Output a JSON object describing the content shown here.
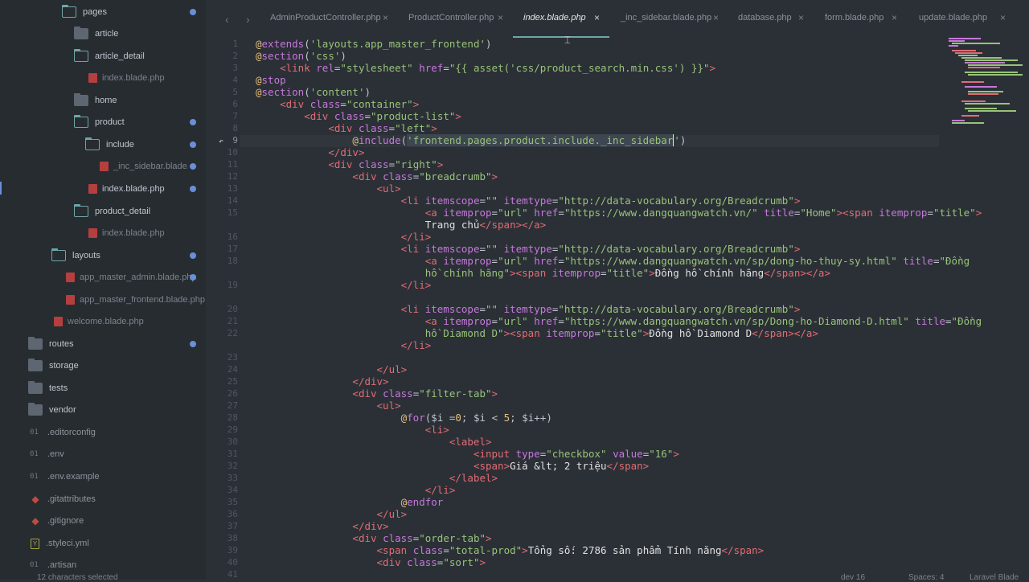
{
  "sidebar": {
    "items": [
      {
        "label": "pages",
        "type": "folder-open",
        "dot": true
      },
      {
        "label": "article",
        "type": "folder-closed",
        "dot": false
      },
      {
        "label": "article_detail",
        "type": "folder-open",
        "dot": false
      },
      {
        "label": "index.blade.php",
        "type": "blade",
        "dot": false
      },
      {
        "label": "home",
        "type": "folder-closed",
        "dot": false
      },
      {
        "label": "product",
        "type": "folder-open",
        "dot": true
      },
      {
        "label": "include",
        "type": "folder-open",
        "dot": true
      },
      {
        "label": "_inc_sidebar.blade.p",
        "type": "blade",
        "dot": true
      },
      {
        "label": "index.blade.php",
        "type": "blade",
        "dot": true
      },
      {
        "label": "product_detail",
        "type": "folder-open",
        "dot": false
      },
      {
        "label": "index.blade.php",
        "type": "blade",
        "dot": false
      },
      {
        "label": "layouts",
        "type": "folder-open",
        "dot": true
      },
      {
        "label": "app_master_admin.blade.php",
        "type": "blade",
        "dot": true
      },
      {
        "label": "app_master_frontend.blade.php",
        "type": "blade",
        "dot": false
      },
      {
        "label": "welcome.blade.php",
        "type": "blade",
        "dot": false
      },
      {
        "label": "routes",
        "type": "folder-closed",
        "dot": true
      },
      {
        "label": "storage",
        "type": "folder-closed",
        "dot": false
      },
      {
        "label": "tests",
        "type": "folder-closed",
        "dot": false
      },
      {
        "label": "vendor",
        "type": "folder-closed",
        "dot": false
      },
      {
        "label": ".editorconfig",
        "type": "text",
        "dot": false
      },
      {
        "label": ".env",
        "type": "text",
        "dot": false
      },
      {
        "label": ".env.example",
        "type": "text",
        "dot": false
      },
      {
        "label": ".gitattributes",
        "type": "git",
        "dot": false
      },
      {
        "label": ".gitignore",
        "type": "git",
        "dot": false
      },
      {
        "label": ".styleci.yml",
        "type": "yml",
        "dot": false
      },
      {
        "label": ".artisan",
        "type": "text",
        "dot": false
      }
    ],
    "text_icon": "01",
    "yml_icon": "Y",
    "git_icon": "◆"
  },
  "tabs": [
    {
      "label": "AdminProductController.php",
      "active": false
    },
    {
      "label": "ProductController.php",
      "active": false
    },
    {
      "label": "index.blade.php",
      "active": true
    },
    {
      "label": "_inc_sidebar.blade.php",
      "active": false
    },
    {
      "label": "database.php",
      "active": false
    },
    {
      "label": "form.blade.php",
      "active": false
    },
    {
      "label": "update.blade.php",
      "active": false
    }
  ],
  "tab_close_glyph": "×",
  "nav": {
    "back": "‹",
    "forward": "›"
  },
  "git_marker": "↶",
  "mouse_cursor": "⌶",
  "line_numbers": [
    "1",
    "2",
    "3",
    "4",
    "5",
    "6",
    "7",
    "8",
    "9",
    "10",
    "11",
    "12",
    "13",
    "14",
    "15",
    "",
    "16",
    "17",
    "18",
    "",
    "19",
    "",
    "20",
    "21",
    "22",
    "",
    "23",
    "24",
    "25",
    "26",
    "27",
    "28",
    "29",
    "30",
    "31",
    "32",
    "33",
    "34",
    "35",
    "36",
    "37",
    "38",
    "39",
    "40",
    "41"
  ],
  "current_line": "9",
  "status": {
    "selection": "12 characters selected",
    "encoding": "dev",
    "count": "16",
    "spaces": "Spaces: 4",
    "syntax": "Laravel Blade"
  }
}
